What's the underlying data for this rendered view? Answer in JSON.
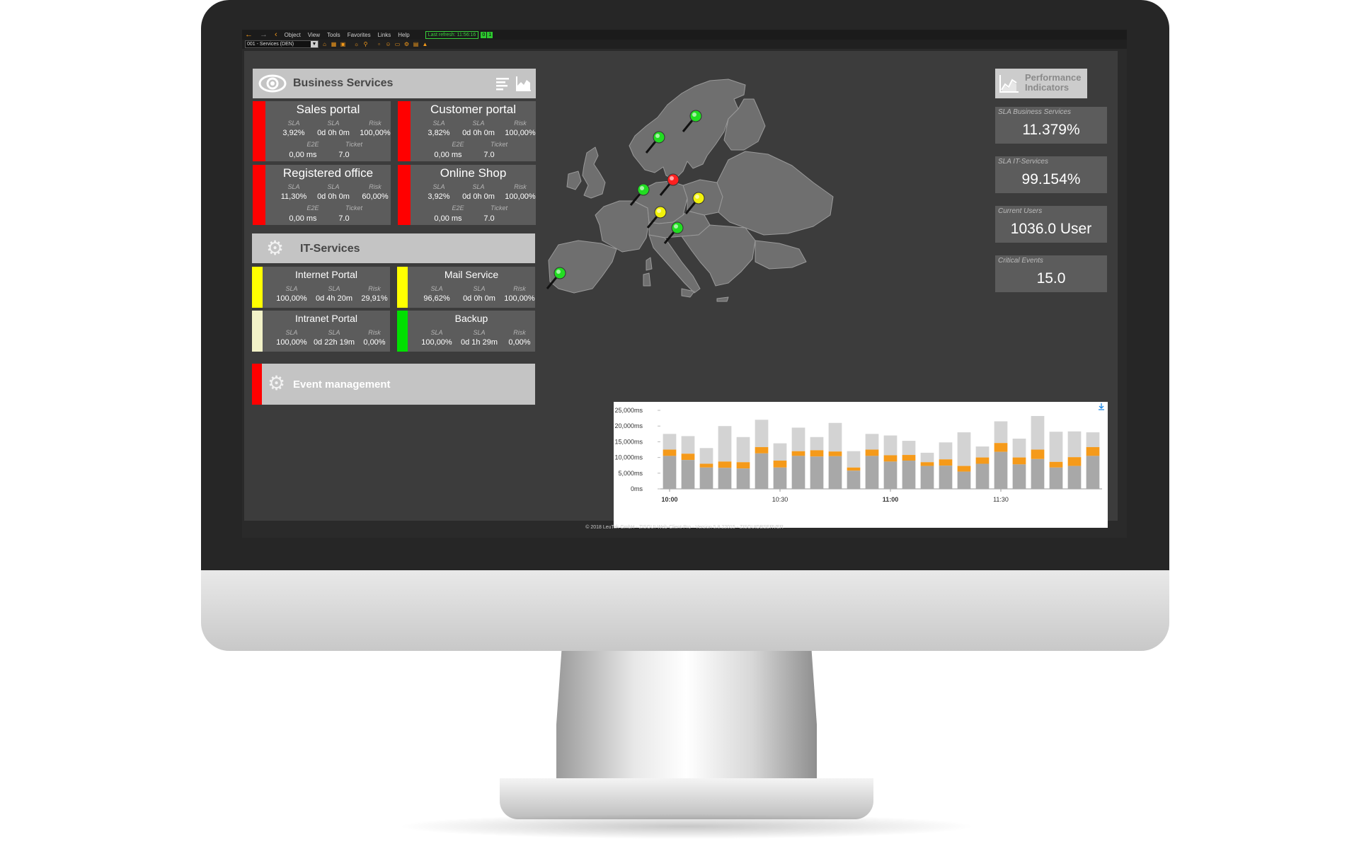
{
  "menu": {
    "object": "Object",
    "view": "View",
    "tools": "Tools",
    "favorites": "Favorites",
    "links": "Links",
    "help": "Help",
    "last_refresh": "Last refresh: 11:56:16",
    "badge_left": "0",
    "badge_right": "1"
  },
  "toolbar": {
    "view_select": "001 - Services (DEN)"
  },
  "business": {
    "title": "Business Services",
    "cards": [
      {
        "name": "Sales portal",
        "status": "#ff0000",
        "sla_label": "SLA",
        "sla": "3,92%",
        "sla2_label": "SLA",
        "sla2": "0d 0h 0m",
        "risk_label": "Risk",
        "risk": "100,00%",
        "e2e_label": "E2E",
        "e2e": "0,00   ms",
        "ticket_label": "Ticket",
        "ticket": "7.0"
      },
      {
        "name": "Customer portal",
        "status": "#ff0000",
        "sla_label": "SLA",
        "sla": "3,82%",
        "sla2_label": "SLA",
        "sla2": "0d 0h 0m",
        "risk_label": "Risk",
        "risk": "100,00%",
        "e2e_label": "E2E",
        "e2e": "0,00   ms",
        "ticket_label": "Ticket",
        "ticket": "7.0"
      },
      {
        "name": "Registered office",
        "status": "#ff0000",
        "sla_label": "SLA",
        "sla": "11,30%",
        "sla2_label": "SLA",
        "sla2": "0d 0h 0m",
        "risk_label": "Risk",
        "risk": "60,00%",
        "e2e_label": "E2E",
        "e2e": "0,00   ms",
        "ticket_label": "Ticket",
        "ticket": "7.0"
      },
      {
        "name": "Online Shop",
        "status": "#ff0000",
        "sla_label": "SLA",
        "sla": "3,92%",
        "sla2_label": "SLA",
        "sla2": "0d 0h 0m",
        "risk_label": "Risk",
        "risk": "100,00%",
        "e2e_label": "E2E",
        "e2e": "0,00   ms",
        "ticket_label": "Ticket",
        "ticket": "7.0"
      }
    ]
  },
  "it": {
    "title": "IT-Services",
    "cards": [
      {
        "name": "Internet Portal",
        "status": "#ffff00",
        "sla_label": "SLA",
        "sla": "100,00%",
        "sla2_label": "SLA",
        "sla2": "0d 4h 20m",
        "risk_label": "Risk",
        "risk": "29,91%"
      },
      {
        "name": "Mail Service",
        "status": "#ffff00",
        "sla_label": "SLA",
        "sla": "96,62%",
        "sla2_label": "SLA",
        "sla2": "0d 0h 0m",
        "risk_label": "Risk",
        "risk": "100,00%"
      },
      {
        "name": "Intranet Portal",
        "status": "#f2f2c8",
        "sla_label": "SLA",
        "sla": "100,00%",
        "sla2_label": "SLA",
        "sla2": "0d 22h 19m",
        "risk_label": "Risk",
        "risk": "0,00%"
      },
      {
        "name": "Backup",
        "status": "#00e000",
        "sla_label": "SLA",
        "sla": "100,00%",
        "sla2_label": "SLA",
        "sla2": "0d 1h 29m",
        "risk_label": "Risk",
        "risk": "0,00%"
      }
    ]
  },
  "event": {
    "title": "Event management",
    "status": "#ff0000"
  },
  "performance": {
    "title_line1": "Performance",
    "title_line2": "Indicators",
    "kpis": [
      {
        "label": "SLA Business Services",
        "value": "11.379%"
      },
      {
        "label": "SLA IT-Services",
        "value": "99.154%"
      },
      {
        "label": "Current Users",
        "value": "1036.0 User"
      },
      {
        "label": "Critical Events",
        "value": "15.0"
      }
    ]
  },
  "map": {
    "pins": [
      {
        "location": "Sweden",
        "color": "#22dd22"
      },
      {
        "location": "Norway",
        "color": "#22dd22"
      },
      {
        "location": "Germany (north)",
        "color": "#ff2020"
      },
      {
        "location": "Netherlands",
        "color": "#22dd22"
      },
      {
        "location": "Czech Republic",
        "color": "#f2f20a"
      },
      {
        "location": "Germany (south)",
        "color": "#f2f20a"
      },
      {
        "location": "Northern Italy",
        "color": "#22dd22"
      },
      {
        "location": "Portugal",
        "color": "#22dd22"
      }
    ]
  },
  "chart_data": {
    "type": "bar",
    "stacked": true,
    "y_ticks": [
      "25,000ms",
      "20,000ms",
      "15,000ms",
      "10,000ms",
      "5,000ms",
      "0ms"
    ],
    "ylim": [
      0,
      25000
    ],
    "x_ticks": [
      {
        "label": "10:00",
        "index": 0,
        "bold": true
      },
      {
        "label": "10:30",
        "index": 6,
        "bold": false
      },
      {
        "label": "11:00",
        "index": 12,
        "bold": true
      },
      {
        "label": "11:30",
        "index": 18,
        "bold": false
      }
    ],
    "series_colors": [
      "#a8a8a8",
      "#f59a1a",
      "#d3d3d3"
    ],
    "bars": [
      {
        "base": 10500,
        "mid": 2000,
        "total": 17500
      },
      {
        "base": 9200,
        "mid": 2000,
        "total": 16800
      },
      {
        "base": 6800,
        "mid": 1200,
        "total": 13000
      },
      {
        "base": 6700,
        "mid": 2000,
        "total": 20000
      },
      {
        "base": 6500,
        "mid": 2000,
        "total": 16500
      },
      {
        "base": 11300,
        "mid": 2000,
        "total": 22000
      },
      {
        "base": 6800,
        "mid": 2200,
        "total": 14500
      },
      {
        "base": 10500,
        "mid": 1500,
        "total": 19500
      },
      {
        "base": 10300,
        "mid": 2000,
        "total": 16500
      },
      {
        "base": 10400,
        "mid": 1500,
        "total": 21000
      },
      {
        "base": 5800,
        "mid": 1000,
        "total": 12000
      },
      {
        "base": 10500,
        "mid": 2000,
        "total": 17500
      },
      {
        "base": 8700,
        "mid": 2000,
        "total": 17000
      },
      {
        "base": 9000,
        "mid": 1800,
        "total": 15300
      },
      {
        "base": 7300,
        "mid": 1200,
        "total": 11500
      },
      {
        "base": 7400,
        "mid": 2000,
        "total": 14800
      },
      {
        "base": 5500,
        "mid": 1800,
        "total": 18000
      },
      {
        "base": 8000,
        "mid": 2000,
        "total": 13500
      },
      {
        "base": 11800,
        "mid": 2800,
        "total": 21500
      },
      {
        "base": 7800,
        "mid": 2200,
        "total": 16000
      },
      {
        "base": 9500,
        "mid": 3000,
        "total": 23200
      },
      {
        "base": 6800,
        "mid": 1800,
        "total": 18200
      },
      {
        "base": 7300,
        "mid": 2800,
        "total": 18300
      },
      {
        "base": 10500,
        "mid": 2800,
        "total": 18000
      }
    ]
  }
}
